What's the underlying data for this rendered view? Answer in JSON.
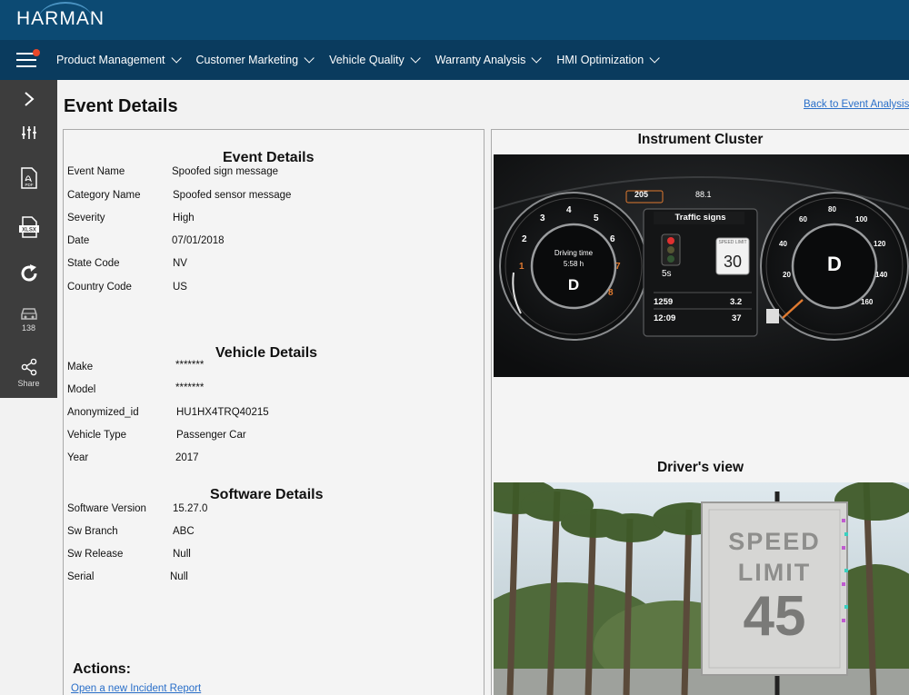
{
  "brand": {
    "name": "HARMAN"
  },
  "nav": {
    "items": [
      {
        "label": "Product Management"
      },
      {
        "label": "Customer Marketing"
      },
      {
        "label": "Vehicle Quality"
      },
      {
        "label": "Warranty Analysis"
      },
      {
        "label": "HMI Optimization"
      }
    ]
  },
  "sidebar": {
    "items": [
      {
        "icon": "chevron-right-icon"
      },
      {
        "icon": "sliders-icon"
      },
      {
        "icon": "pdf-icon",
        "badge": "PDF"
      },
      {
        "icon": "xlsx-icon",
        "badge": "XLSX"
      },
      {
        "icon": "refresh-icon"
      },
      {
        "icon": "car-icon",
        "count": "138"
      },
      {
        "icon": "share-icon",
        "label": "Share"
      }
    ]
  },
  "page": {
    "title": "Event Details",
    "back_link": "Back to Event Analysis"
  },
  "event_details": {
    "title": "Event Details",
    "rows": [
      {
        "label": "Event Name",
        "value": "Spoofed sign message"
      },
      {
        "label": "Category Name",
        "value": "Spoofed sensor message"
      },
      {
        "label": "Severity",
        "value": "High"
      },
      {
        "label": "Date",
        "value": "07/01/2018"
      },
      {
        "label": "State Code",
        "value": "NV"
      },
      {
        "label": "Country Code",
        "value": "US"
      }
    ]
  },
  "vehicle_details": {
    "title": "Vehicle Details",
    "rows": [
      {
        "label": "Make",
        "value": "*******"
      },
      {
        "label": "Model",
        "value": "*******"
      },
      {
        "label": "Anonymized_id",
        "value": "HU1HX4TRQ40215"
      },
      {
        "label": "Vehicle Type",
        "value": "Passenger Car"
      },
      {
        "label": "Year",
        "value": "2017"
      }
    ]
  },
  "software_details": {
    "title": "Software Details",
    "rows": [
      {
        "label": "Software Version",
        "value": "15.27.0"
      },
      {
        "label": "Sw Branch",
        "value": "ABC"
      },
      {
        "label": "Sw Release",
        "value": "Null"
      },
      {
        "label": "Serial",
        "value": "Null"
      }
    ]
  },
  "actions": {
    "title": "Actions:",
    "link": "Open a new Incident Report"
  },
  "instrument_cluster": {
    "title": "Instrument Cluster",
    "range": "205",
    "temp": "88.1",
    "center_title": "Traffic signs",
    "sign_top": "SPEED LIMIT",
    "sign_value": "30",
    "countdown": "5s",
    "driving_time_label": "Driving time",
    "driving_time": "5:58 h",
    "left_gear": "D",
    "right_gear": "D",
    "odometer": "1259",
    "trip": "3.2",
    "clock": "12:09",
    "outside_temp": "37",
    "left_ticks": [
      "1",
      "2",
      "3",
      "4",
      "5",
      "6",
      "7",
      "8"
    ],
    "right_ticks": [
      "20",
      "40",
      "60",
      "80",
      "100",
      "120",
      "140",
      "160"
    ]
  },
  "drivers_view": {
    "title": "Driver's view",
    "sign_line1": "SPEED",
    "sign_line2": "LIMIT",
    "sign_value": "45"
  }
}
